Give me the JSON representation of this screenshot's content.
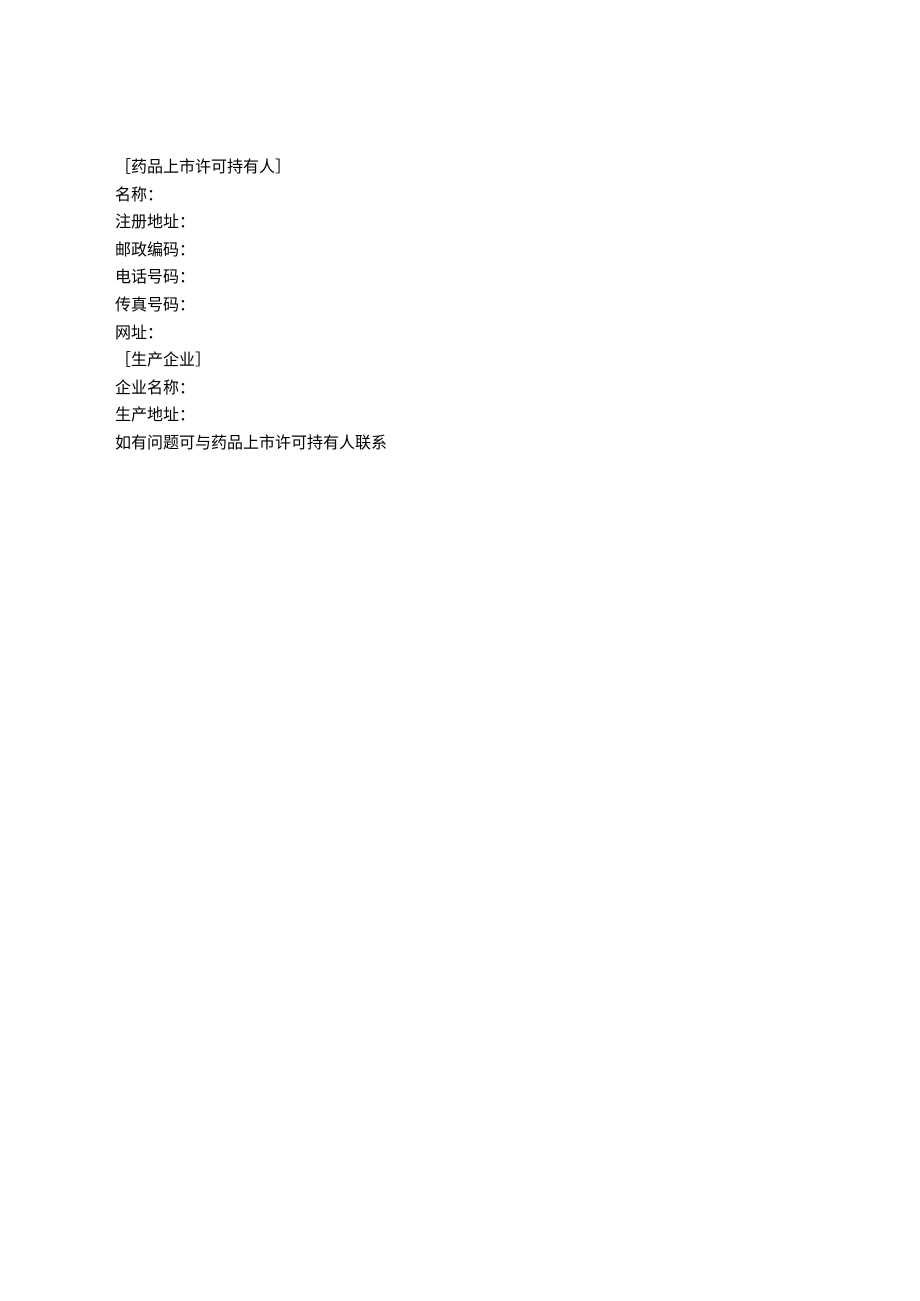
{
  "lines": [
    "［药品上市许可持有人］",
    "名称：",
    "注册地址：",
    "邮政编码：",
    "电话号码：",
    "传真号码：",
    "网址：",
    "［生产企业］",
    "企业名称：",
    "生产地址：",
    "如有问题可与药品上市许可持有人联系"
  ]
}
